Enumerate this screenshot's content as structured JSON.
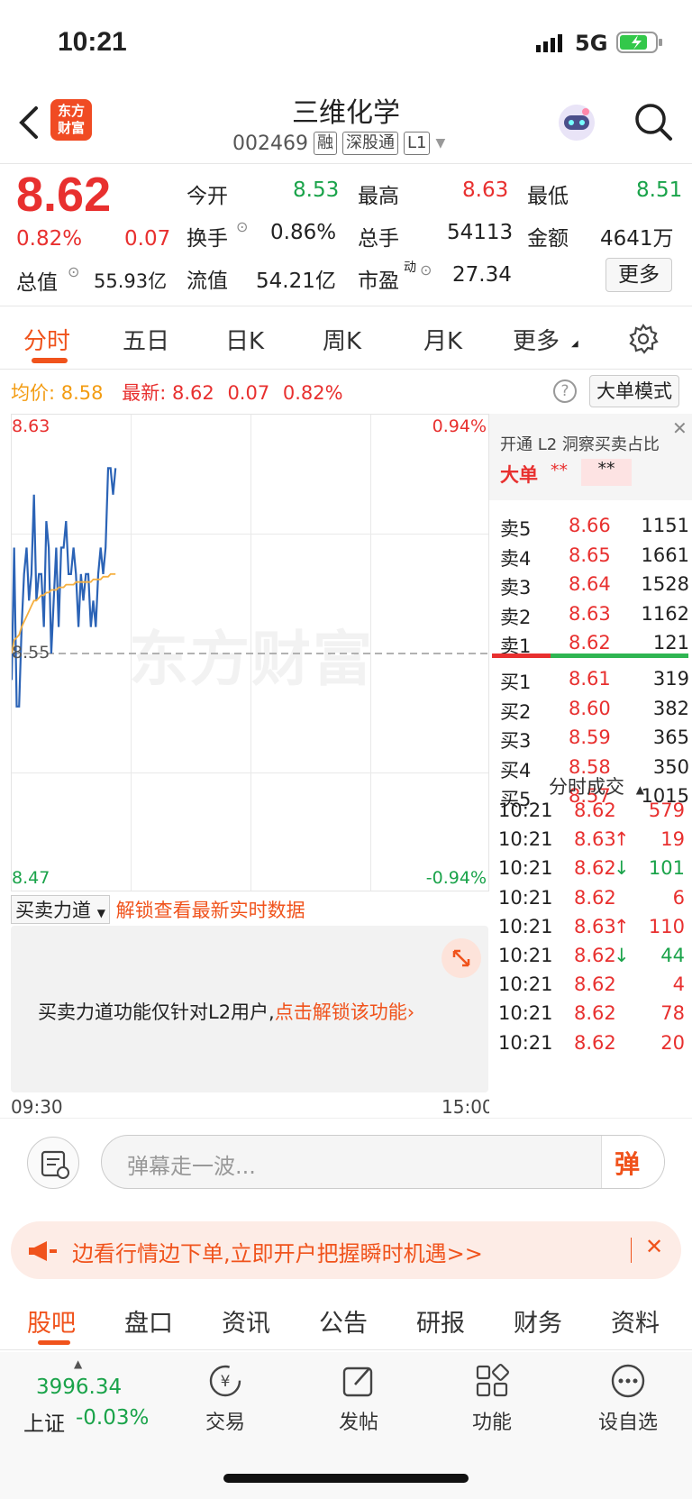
{
  "status": {
    "time": "10:21",
    "network": "5G"
  },
  "header": {
    "logo_text": "东方财富",
    "stock_name": "三维化学",
    "stock_code": "002469",
    "tags": [
      "融",
      "深股通",
      "L1"
    ]
  },
  "quote": {
    "price": "8.62",
    "change_pct": "0.82%",
    "change": "0.07",
    "total_value_label": "总值",
    "total_value": "55.93亿",
    "fields": [
      {
        "label": "今开",
        "value": "8.53"
      },
      {
        "label": "最高",
        "value": "8.63"
      },
      {
        "label": "最低",
        "value": "8.51"
      },
      {
        "label": "换手",
        "value": "0.86%"
      },
      {
        "label": "总手",
        "value": "54113"
      },
      {
        "label": "金额",
        "value": "4641万"
      },
      {
        "label": "流值",
        "value": "54.21亿"
      },
      {
        "label": "市盈",
        "sup": "动",
        "value": "27.34"
      }
    ],
    "more_button": "更多"
  },
  "tabs": [
    "分时",
    "五日",
    "日K",
    "周K",
    "月K",
    "更多"
  ],
  "infoline": {
    "avg_label": "均价:",
    "avg_value": "8.58",
    "last_label": "最新:",
    "last_value": "8.62",
    "change": "0.07",
    "change_pct": "0.82%",
    "mode_button": "大单模式"
  },
  "chart_data": {
    "type": "line",
    "title": "",
    "x_start": "09:30",
    "x_end": "15:00",
    "y_max_label": "8.63",
    "y_min_label": "8.47",
    "y_ref_label": "8.55",
    "pct_max_label": "0.94%",
    "pct_min_label": "-0.94%",
    "ylim": [
      8.47,
      8.63
    ],
    "reference": 8.55,
    "watermark": "东方财富",
    "series": [
      {
        "values": [
          8.54,
          8.59,
          8.53,
          8.53,
          8.56,
          8.58,
          8.59,
          8.57,
          8.58,
          8.61,
          8.57,
          8.58,
          8.58,
          8.56,
          8.6,
          8.59,
          8.55,
          8.57,
          8.59,
          8.56,
          8.59,
          8.59,
          8.6,
          8.58,
          8.58,
          8.59,
          8.58,
          8.56,
          8.58,
          8.57,
          8.58,
          8.58,
          8.56,
          8.57,
          8.56,
          8.58,
          8.59,
          8.58,
          8.59,
          8.62,
          8.62,
          8.61,
          8.62
        ]
      },
      {
        "values": [
          8.55,
          8.555,
          8.556,
          8.557,
          8.56,
          8.562,
          8.564,
          8.566,
          8.568,
          8.57,
          8.57,
          8.571,
          8.572,
          8.572,
          8.573,
          8.573,
          8.574,
          8.574,
          8.574,
          8.575,
          8.575,
          8.575,
          8.576,
          8.576,
          8.576,
          8.576,
          8.577,
          8.577,
          8.577,
          8.577,
          8.577,
          8.577,
          8.577,
          8.578,
          8.578,
          8.578,
          8.578,
          8.579,
          8.579,
          8.579,
          8.58,
          8.58,
          8.58
        ]
      }
    ]
  },
  "orderbook": {
    "promo": "开通 L2 洞察买卖占比",
    "big_label": "大单",
    "big_val1": "**",
    "big_val2": "**",
    "asks": [
      {
        "label": "卖5",
        "price": "8.66",
        "vol": "1151"
      },
      {
        "label": "卖4",
        "price": "8.65",
        "vol": "1661"
      },
      {
        "label": "卖3",
        "price": "8.64",
        "vol": "1528"
      },
      {
        "label": "卖2",
        "price": "8.63",
        "vol": "1162"
      },
      {
        "label": "卖1",
        "price": "8.62",
        "vol": "121"
      }
    ],
    "bids": [
      {
        "label": "买1",
        "price": "8.61",
        "vol": "319"
      },
      {
        "label": "买2",
        "price": "8.60",
        "vol": "382"
      },
      {
        "label": "买3",
        "price": "8.59",
        "vol": "365"
      },
      {
        "label": "买4",
        "price": "8.58",
        "vol": "350"
      },
      {
        "label": "买5",
        "price": "8.57",
        "vol": "1015"
      }
    ],
    "buy_ratio": 0.3,
    "trades_title": "分时成交",
    "trades": [
      {
        "t": "10:21",
        "p": "8.62",
        "arrow": "",
        "v": "579",
        "vc": "red"
      },
      {
        "t": "10:21",
        "p": "8.63",
        "arrow": "↑",
        "v": "19",
        "vc": "red"
      },
      {
        "t": "10:21",
        "p": "8.62",
        "arrow": "↓",
        "v": "101",
        "vc": "green"
      },
      {
        "t": "10:21",
        "p": "8.62",
        "arrow": "",
        "v": "6",
        "vc": "red"
      },
      {
        "t": "10:21",
        "p": "8.63",
        "arrow": "↑",
        "v": "110",
        "vc": "red"
      },
      {
        "t": "10:21",
        "p": "8.62",
        "arrow": "↓",
        "v": "44",
        "vc": "green"
      },
      {
        "t": "10:21",
        "p": "8.62",
        "arrow": "",
        "v": "4",
        "vc": "red"
      },
      {
        "t": "10:21",
        "p": "8.62",
        "arrow": "",
        "v": "78",
        "vc": "red"
      },
      {
        "t": "10:21",
        "p": "8.62",
        "arrow": "",
        "v": "20",
        "vc": "red"
      }
    ]
  },
  "force": {
    "title": "买卖力道",
    "unlock_hint": "解锁查看最新实时数据",
    "panel_text": "买卖力道功能仅针对L2用户,",
    "panel_link": "点击解锁该功能"
  },
  "comment": {
    "placeholder": "弹幕走一波...",
    "danmu": "弹"
  },
  "promo": {
    "text": "边看行情边下单,立即开户把握瞬时机遇>>"
  },
  "bottom_tabs": [
    "股吧",
    "盘口",
    "资讯",
    "公告",
    "研报",
    "财务",
    "资料"
  ],
  "footer": {
    "index_value": "3996.34",
    "index_name": "上证",
    "index_change": "-0.03%",
    "items": [
      "交易",
      "发帖",
      "功能",
      "设自选"
    ]
  }
}
